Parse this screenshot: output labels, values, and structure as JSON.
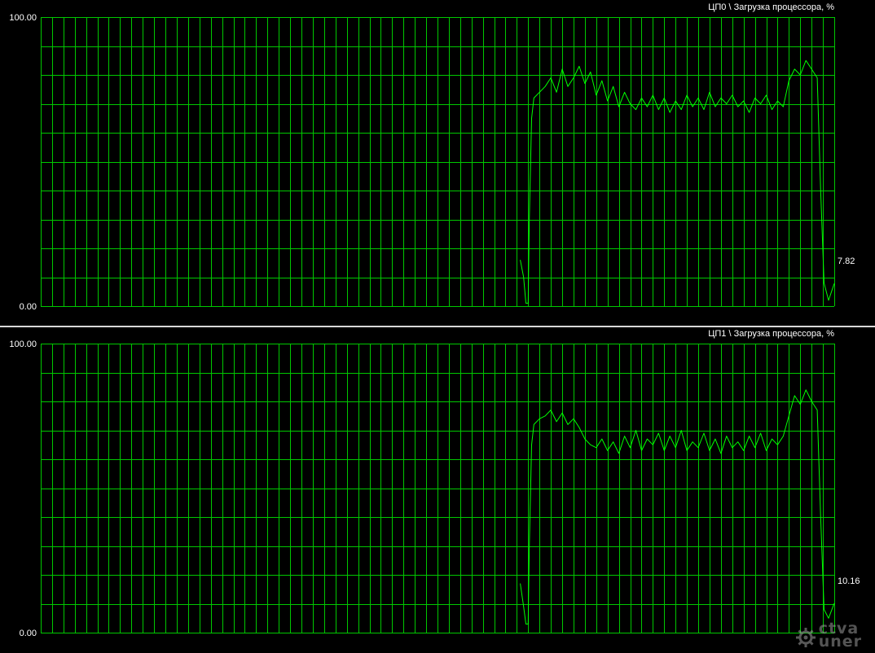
{
  "chart_data": [
    {
      "type": "line",
      "title": "ЦП0 \\ Загрузка процессора, %",
      "y_tick_labels": [
        "100.00",
        "0.00"
      ],
      "ylim": [
        0,
        100
      ],
      "x_divisions": 70,
      "y_divisions": 10,
      "current_value_label": "7.82",
      "series": [
        {
          "color": "#00ff00",
          "points": [
            [
              0,
              null
            ],
            [
              40,
              null
            ],
            [
              42,
              null
            ],
            [
              42.3,
              16
            ],
            [
              42.6,
              10
            ],
            [
              42.8,
              1
            ],
            [
              43.0,
              1
            ],
            [
              43.1,
              30
            ],
            [
              43.3,
              65
            ],
            [
              43.5,
              72
            ],
            [
              44.0,
              74
            ],
            [
              44.5,
              76
            ],
            [
              45.0,
              79
            ],
            [
              45.5,
              74
            ],
            [
              46.0,
              82
            ],
            [
              46.5,
              76
            ],
            [
              47.0,
              79
            ],
            [
              47.5,
              83
            ],
            [
              48.0,
              77
            ],
            [
              48.5,
              81
            ],
            [
              49.0,
              73
            ],
            [
              49.5,
              78
            ],
            [
              50.0,
              71
            ],
            [
              50.5,
              76
            ],
            [
              51.0,
              69
            ],
            [
              51.5,
              74
            ],
            [
              52.0,
              70
            ],
            [
              52.5,
              68
            ],
            [
              53.0,
              72
            ],
            [
              53.5,
              69
            ],
            [
              54.0,
              73
            ],
            [
              54.5,
              68
            ],
            [
              55.0,
              72
            ],
            [
              55.5,
              67
            ],
            [
              56.0,
              71
            ],
            [
              56.5,
              68
            ],
            [
              57.0,
              73
            ],
            [
              57.5,
              69
            ],
            [
              58.0,
              72
            ],
            [
              58.5,
              68
            ],
            [
              59.0,
              74
            ],
            [
              59.5,
              69
            ],
            [
              60.0,
              72
            ],
            [
              60.5,
              70
            ],
            [
              61.0,
              73
            ],
            [
              61.5,
              69
            ],
            [
              62.0,
              71
            ],
            [
              62.5,
              67
            ],
            [
              63.0,
              72
            ],
            [
              63.5,
              70
            ],
            [
              64.0,
              73
            ],
            [
              64.5,
              68
            ],
            [
              65.0,
              71
            ],
            [
              65.5,
              69
            ],
            [
              66.0,
              78
            ],
            [
              66.5,
              82
            ],
            [
              67.0,
              80
            ],
            [
              67.5,
              85
            ],
            [
              68.0,
              82
            ],
            [
              68.5,
              79
            ],
            [
              68.8,
              40
            ],
            [
              69.1,
              8
            ],
            [
              69.5,
              2
            ],
            [
              70.0,
              7.82
            ]
          ]
        }
      ]
    },
    {
      "type": "line",
      "title": "ЦП1 \\ Загрузка процессора, %",
      "y_tick_labels": [
        "100.00",
        "0.00"
      ],
      "ylim": [
        0,
        100
      ],
      "x_divisions": 70,
      "y_divisions": 10,
      "current_value_label": "10.16",
      "series": [
        {
          "color": "#00ff00",
          "points": [
            [
              0,
              null
            ],
            [
              40,
              null
            ],
            [
              42,
              null
            ],
            [
              42.3,
              17
            ],
            [
              42.6,
              9
            ],
            [
              42.8,
              3
            ],
            [
              43.0,
              3
            ],
            [
              43.1,
              30
            ],
            [
              43.3,
              65
            ],
            [
              43.5,
              72
            ],
            [
              44.0,
              74
            ],
            [
              44.5,
              75
            ],
            [
              45.0,
              77
            ],
            [
              45.5,
              73
            ],
            [
              46.0,
              76
            ],
            [
              46.5,
              72
            ],
            [
              47.0,
              74
            ],
            [
              47.5,
              71
            ],
            [
              48.0,
              67
            ],
            [
              48.5,
              65
            ],
            [
              49.0,
              64
            ],
            [
              49.5,
              67
            ],
            [
              50.0,
              63
            ],
            [
              50.5,
              66
            ],
            [
              51.0,
              62
            ],
            [
              51.5,
              68
            ],
            [
              52.0,
              64
            ],
            [
              52.5,
              70
            ],
            [
              53.0,
              63
            ],
            [
              53.5,
              67
            ],
            [
              54.0,
              65
            ],
            [
              54.5,
              69
            ],
            [
              55.0,
              63
            ],
            [
              55.5,
              68
            ],
            [
              56.0,
              64
            ],
            [
              56.5,
              70
            ],
            [
              57.0,
              63
            ],
            [
              57.5,
              66
            ],
            [
              58.0,
              64
            ],
            [
              58.5,
              69
            ],
            [
              59.0,
              63
            ],
            [
              59.5,
              67
            ],
            [
              60.0,
              62
            ],
            [
              60.5,
              68
            ],
            [
              61.0,
              64
            ],
            [
              61.5,
              66
            ],
            [
              62.0,
              63
            ],
            [
              62.5,
              68
            ],
            [
              63.0,
              64
            ],
            [
              63.5,
              69
            ],
            [
              64.0,
              63
            ],
            [
              64.5,
              67
            ],
            [
              65.0,
              65
            ],
            [
              65.5,
              68
            ],
            [
              66.0,
              75
            ],
            [
              66.5,
              82
            ],
            [
              67.0,
              79
            ],
            [
              67.5,
              84
            ],
            [
              68.0,
              80
            ],
            [
              68.5,
              77
            ],
            [
              68.8,
              40
            ],
            [
              69.1,
              8
            ],
            [
              69.5,
              5
            ],
            [
              70.0,
              10.16
            ]
          ]
        }
      ]
    }
  ],
  "watermark": {
    "line1": "ctva",
    "line2": "uner"
  }
}
